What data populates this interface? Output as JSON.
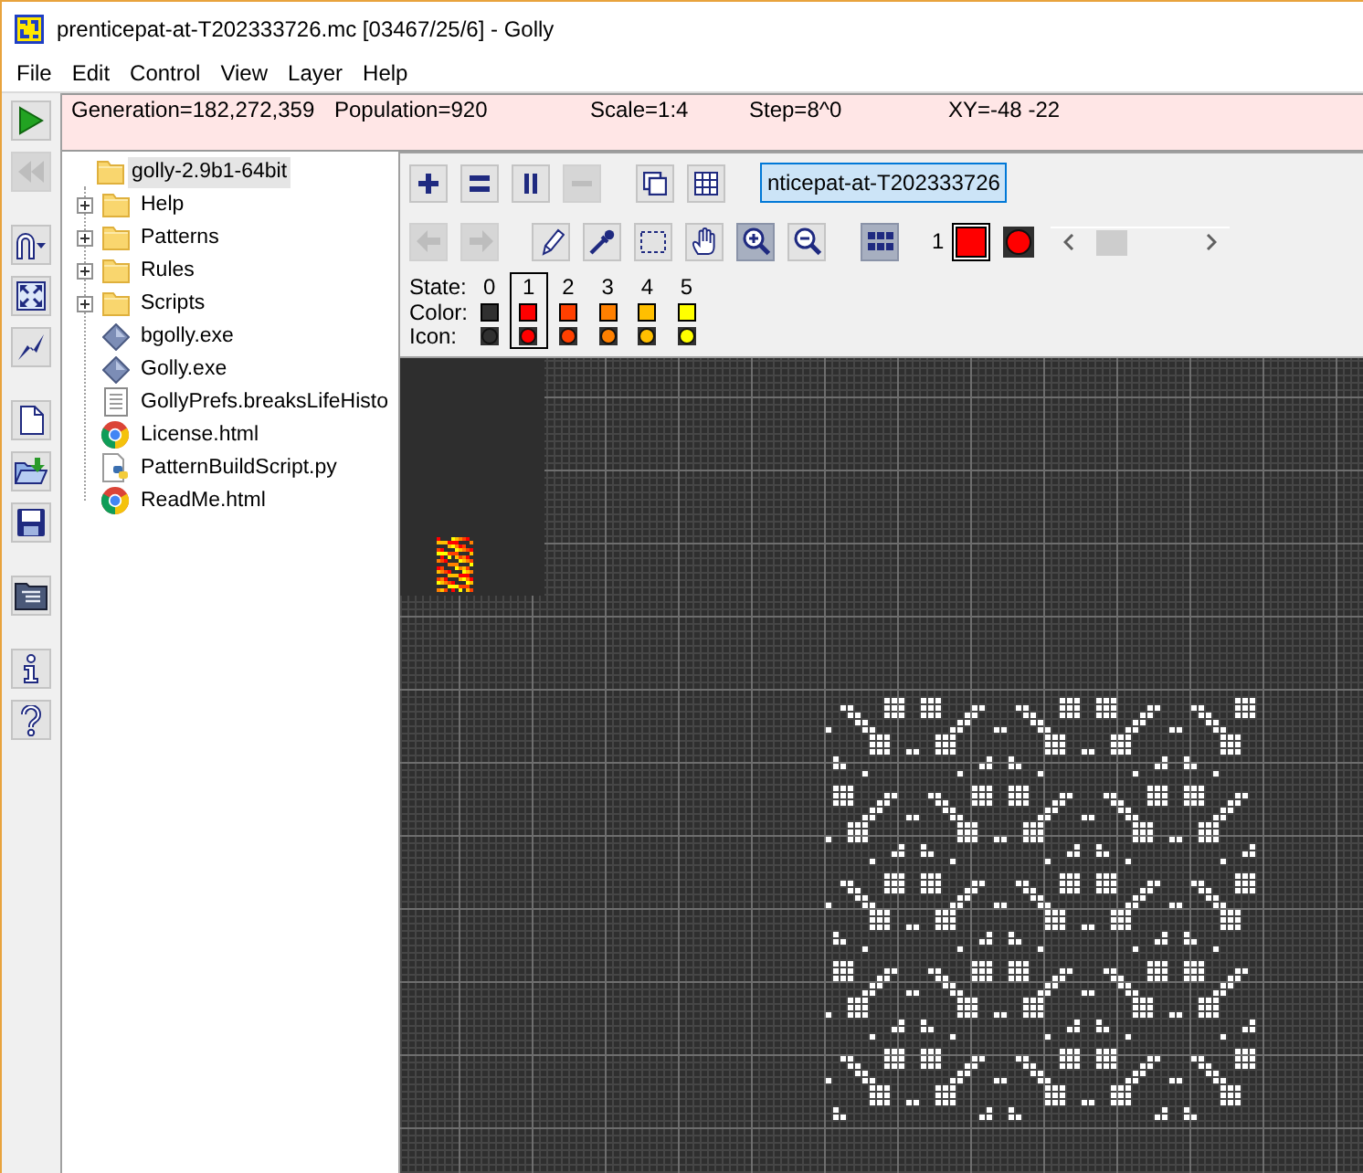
{
  "window": {
    "title": "prenticepat-at-T202333726.mc [03467/25/6] - Golly"
  },
  "menu_bar": [
    "File",
    "Edit",
    "Control",
    "View",
    "Layer",
    "Help"
  ],
  "left_toolbar": {
    "groups": [
      [
        {
          "kind": "play",
          "disabled": false
        },
        {
          "kind": "reset",
          "disabled": true
        }
      ],
      [
        {
          "kind": "algorithm",
          "disabled": false
        },
        {
          "kind": "fit",
          "disabled": false
        },
        {
          "kind": "hyper",
          "disabled": false
        }
      ],
      [
        {
          "kind": "new",
          "disabled": false
        },
        {
          "kind": "open",
          "disabled": false
        },
        {
          "kind": "save",
          "disabled": false
        }
      ],
      [
        {
          "kind": "files",
          "disabled": false
        }
      ],
      [
        {
          "kind": "info",
          "disabled": false
        },
        {
          "kind": "help",
          "disabled": false
        }
      ]
    ]
  },
  "status_bar": [
    "Generation=182,272,359",
    "Population=920",
    "Scale=1:4",
    "Step=8^0",
    "XY=-48 -22"
  ],
  "file_tree": {
    "root": {
      "label": "golly-2.9b1-64bit",
      "kind": "folder",
      "expanded": true,
      "selected": true,
      "children": [
        {
          "label": "Help",
          "kind": "folder",
          "expanded": false,
          "selected": false
        },
        {
          "label": "Patterns",
          "kind": "folder",
          "expanded": false,
          "selected": false
        },
        {
          "label": "Rules",
          "kind": "folder",
          "expanded": false,
          "selected": false
        },
        {
          "label": "Scripts",
          "kind": "folder",
          "expanded": false,
          "selected": false
        },
        {
          "label": "bgolly.exe",
          "kind": "exe",
          "selected": false
        },
        {
          "label": "Golly.exe",
          "kind": "exe",
          "selected": false
        },
        {
          "label": "GollyPrefs.breaksLifeHisto",
          "kind": "text",
          "selected": false
        },
        {
          "label": "License.html",
          "kind": "html",
          "selected": false
        },
        {
          "label": "PatternBuildScript.py",
          "kind": "python",
          "selected": false
        },
        {
          "label": "ReadMe.html",
          "kind": "html",
          "selected": false
        }
      ]
    }
  },
  "layer_bar": {
    "groups": [
      [
        {
          "kind": "add",
          "disabled": false
        },
        {
          "kind": "clone",
          "disabled": false
        },
        {
          "kind": "duplicate",
          "disabled": false
        },
        {
          "kind": "delete",
          "disabled": true
        }
      ],
      [
        {
          "kind": "stack",
          "disabled": false
        },
        {
          "kind": "tile",
          "disabled": false
        }
      ]
    ],
    "layers": [
      {
        "name": "nticepat-at-T202333726",
        "selected": true
      }
    ]
  },
  "edit_bar": {
    "history": [
      {
        "kind": "undo",
        "disabled": true
      },
      {
        "kind": "redo",
        "disabled": true
      }
    ],
    "tools": [
      {
        "kind": "draw",
        "selected": false
      },
      {
        "kind": "pick",
        "selected": false
      },
      {
        "kind": "select",
        "selected": false
      },
      {
        "kind": "move",
        "selected": false
      },
      {
        "kind": "zoom_in",
        "selected": true
      },
      {
        "kind": "zoom_out",
        "selected": false
      }
    ],
    "all_states": {
      "selected": true
    },
    "current_state_label": "1",
    "row_labels": [
      "State:",
      "Color:",
      "Icon:"
    ],
    "states": [
      {
        "label": "0",
        "color": "#303030",
        "selected": false
      },
      {
        "label": "1",
        "color": "#ff0000",
        "selected": true
      },
      {
        "label": "2",
        "color": "#ff4000",
        "selected": false
      },
      {
        "label": "3",
        "color": "#ff8000",
        "selected": false
      },
      {
        "label": "4",
        "color": "#ffbf00",
        "selected": false
      },
      {
        "label": "5",
        "color": "#ffff00",
        "selected": false
      }
    ]
  }
}
